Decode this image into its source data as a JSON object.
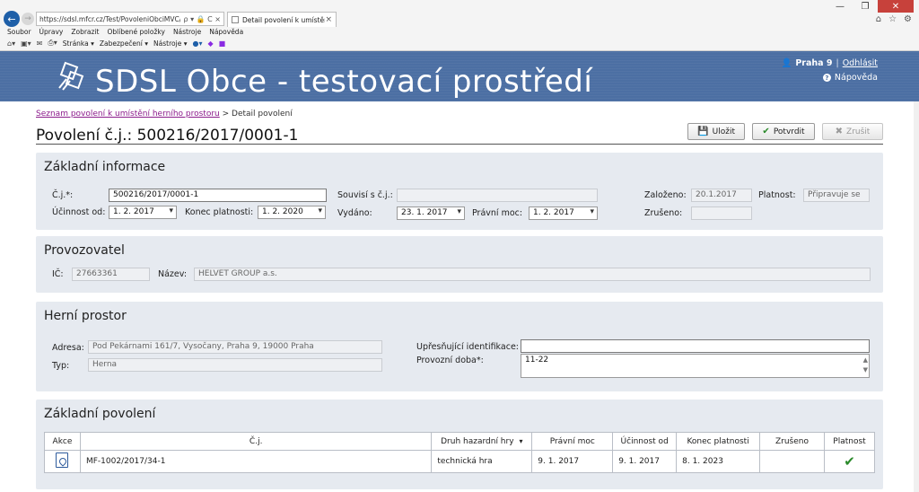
{
  "browser": {
    "address": "https://sdsl.mfcr.cz/Test/PovoleniObciMVC/PovoleniOb",
    "address_icons": "ρ ▾ 🔒 C ×",
    "tab_title": "Detail povolení k umístění ...",
    "tab_close": "×",
    "menu": [
      "Soubor",
      "Úpravy",
      "Zobrazit",
      "Oblíbené položky",
      "Nástroje",
      "Nápověda"
    ],
    "toolbar": [
      "Stránka ▾",
      "Zabezpečení ▾",
      "Nástroje ▾"
    ],
    "window_controls": [
      "—",
      "❐",
      "✕"
    ],
    "right_icons": [
      "⌂",
      "☆",
      "⚙"
    ]
  },
  "header": {
    "title": "SDSL Obce - testovací prostředí",
    "user": "Praha 9",
    "separator": "|",
    "logout": "Odhlásit",
    "help": "Nápověda"
  },
  "breadcrumb": {
    "link": "Seznam povolení k umístění herního prostoru",
    "separator": ">",
    "current": "Detail povolení"
  },
  "page_title": "Povolení č.j.: 500216/2017/0001-1",
  "actions": {
    "save": "Uložit",
    "confirm": "Potvrdit",
    "cancel": "Zrušit"
  },
  "basic_info": {
    "title": "Základní informace",
    "cj_label": "Č.j.*:",
    "cj_value": "500216/2017/0001-1",
    "ucinnost_label": "Účinnost od:",
    "ucinnost_value": "1. 2. 2017",
    "konec_label": "Konec platnosti:",
    "konec_value": "1. 2. 2020",
    "souvisi_label": "Souvisí s č.j.:",
    "souvisi_value": "",
    "vydano_label": "Vydáno:",
    "vydano_value": "23. 1. 2017",
    "pravni_label": "Právní moc:",
    "pravni_value": "1. 2. 2017",
    "zalozeno_label": "Založeno:",
    "zalozeno_value": "20.1.2017",
    "platnost_label": "Platnost:",
    "platnost_value": "Připravuje se",
    "zruseno_label": "Zrušeno:",
    "zruseno_value": ""
  },
  "operator": {
    "title": "Provozovatel",
    "ic_label": "IČ:",
    "ic_value": "27663361",
    "name_label": "Název:",
    "name_value": "HELVET GROUP a.s."
  },
  "premises": {
    "title": "Herní prostor",
    "address_label": "Adresa:",
    "address_value": "Pod Pekárnami 161/7, Vysočany, Praha 9, 19000 Praha",
    "type_label": "Typ:",
    "type_value": "Herna",
    "ident_label": "Upřesňující identifikace:",
    "ident_value": "",
    "hours_label": "Provozní doba*:",
    "hours_value": "11-22"
  },
  "base_permit": {
    "title": "Základní povolení",
    "columns": [
      "Akce",
      "Č.j.",
      "Druh hazardní hry",
      "Právní moc",
      "Účinnost od",
      "Konec platnosti",
      "Zrušeno",
      "Platnost"
    ],
    "rows": [
      [
        "",
        "MF-1002/2017/34-1",
        "technická hra",
        "9. 1. 2017",
        "9. 1. 2017",
        "8. 1. 2023",
        "",
        "✔"
      ]
    ]
  }
}
